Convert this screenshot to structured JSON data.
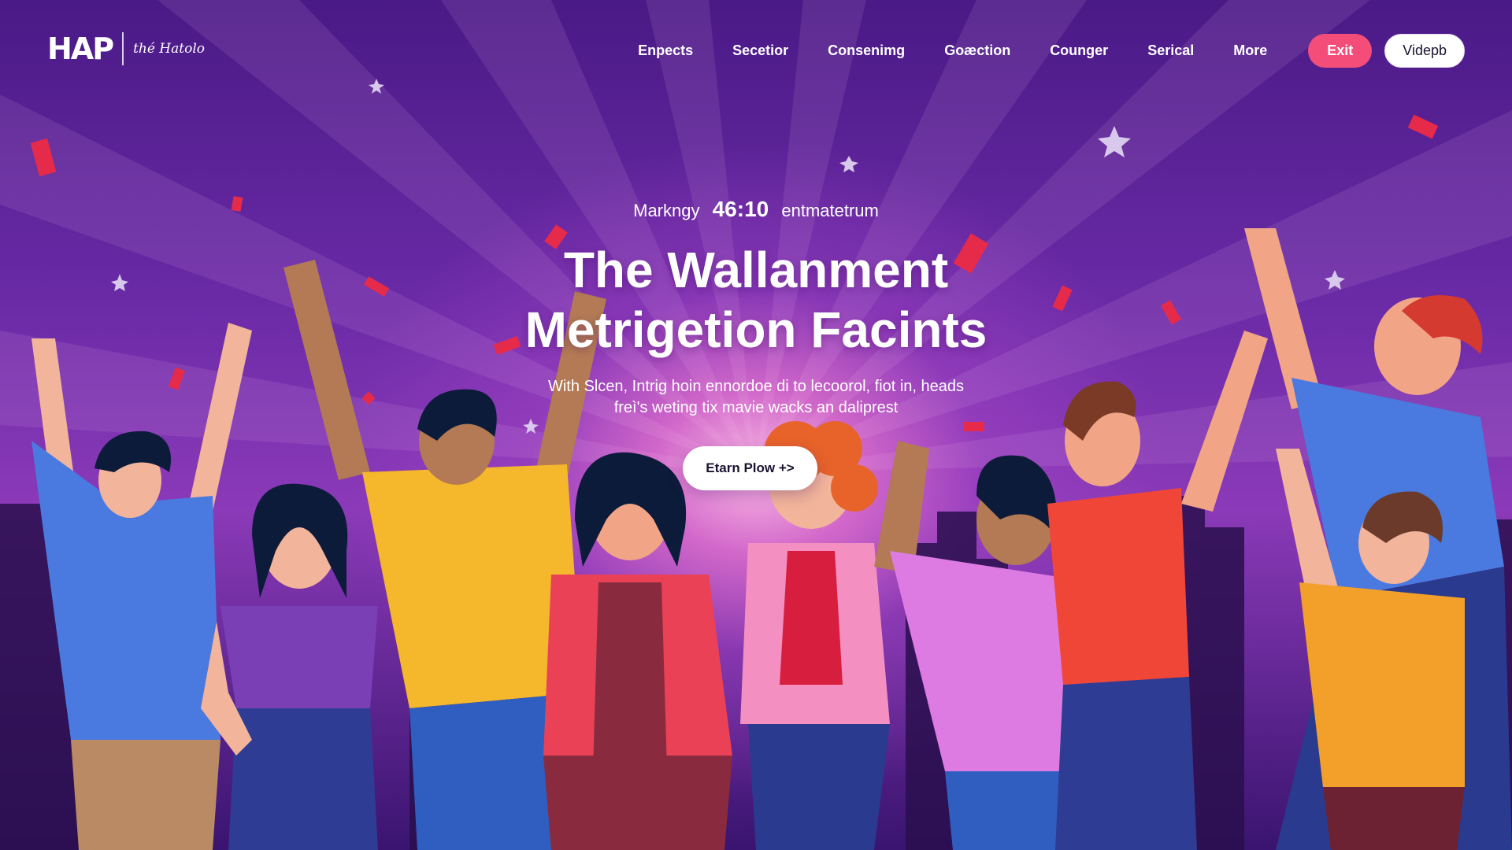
{
  "brand": {
    "logo": "HAP",
    "tagline": "thé Hatolo"
  },
  "nav": {
    "items": [
      "Enpects",
      "Secetior",
      "Consenimg",
      "Goæction",
      "Counger",
      "Serical",
      "More"
    ],
    "exit_label": "Exit",
    "video_label": "Videpb"
  },
  "hero": {
    "eyebrow_prefix": "Markngy",
    "eyebrow_number": "46:10",
    "eyebrow_suffix": "entmatetrum",
    "headline_line1": "The Wallanment",
    "headline_line2": "Metrigetion Facints",
    "subtext_line1": "With Slcen, Intrig hoin ennordoe di to lecoorol, fiot in, heads",
    "subtext_line2": "freì's weting tix mavie wacks an daliprest",
    "cta_label": "Etarn Plow +>"
  },
  "colors": {
    "accent_pink": "#f54d7a",
    "bg_purple": "#4a1a86"
  }
}
